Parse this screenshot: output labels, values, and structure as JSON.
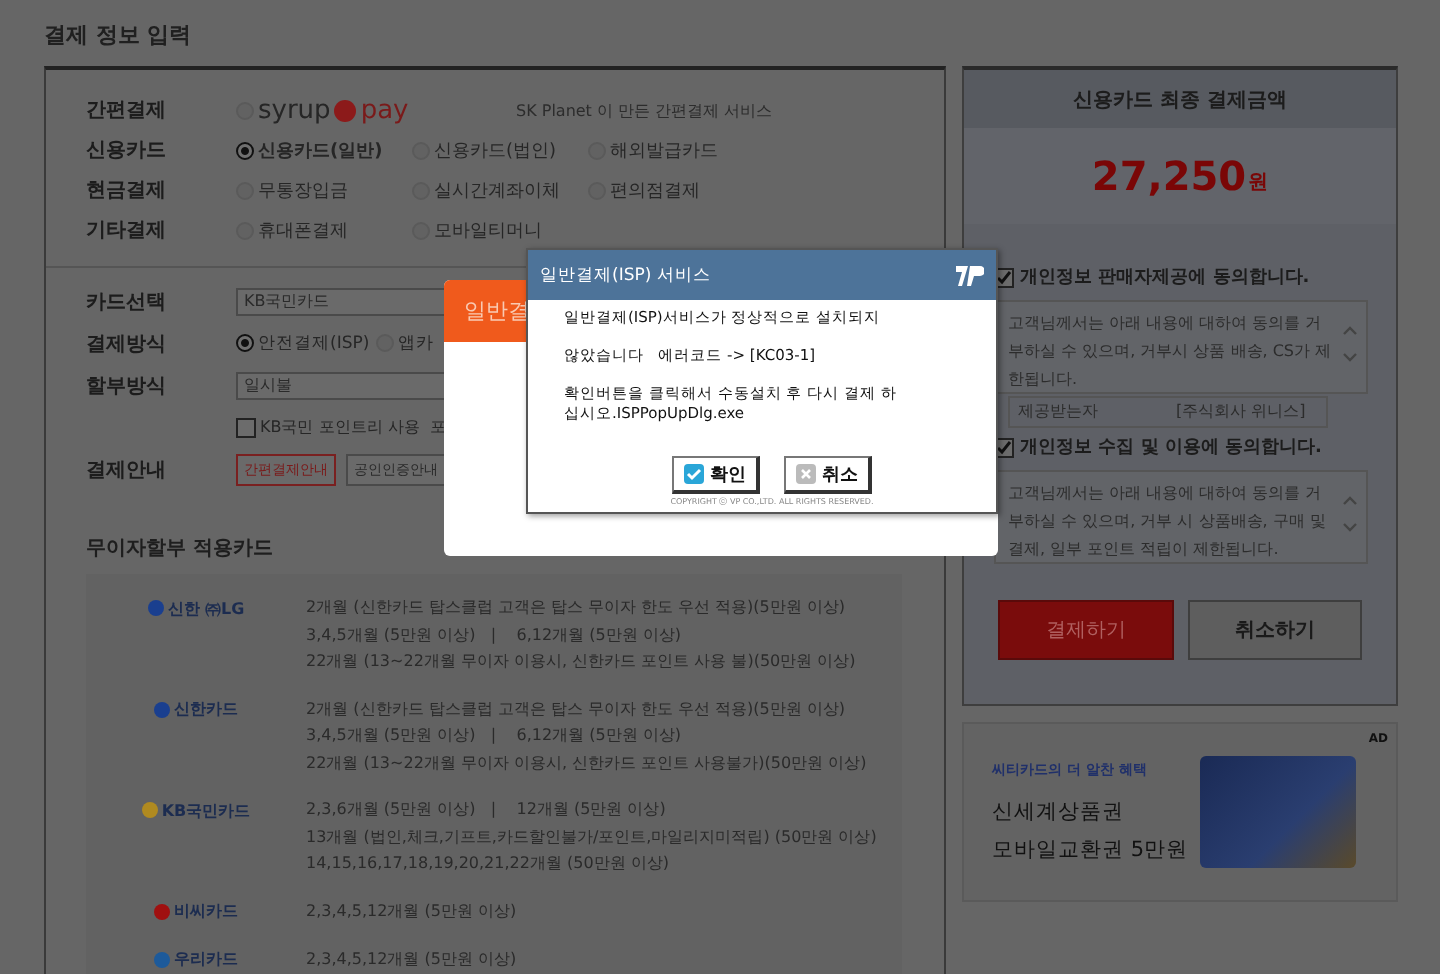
{
  "page_title": "결제 정보 입력",
  "methods": [
    {
      "label": "간편결제",
      "kind": "syrup",
      "options": [
        {
          "brand_left": "syrup",
          "brand_right": "pay",
          "selected": false
        }
      ],
      "note": "SK Planet 이 만든 간편결제 서비스"
    },
    {
      "label": "신용카드",
      "kind": "radios",
      "options": [
        {
          "label": "신용카드(일반)",
          "selected": true
        },
        {
          "label": "신용카드(법인)",
          "selected": false
        },
        {
          "label": "해외발급카드",
          "selected": false
        }
      ]
    },
    {
      "label": "현금결제",
      "kind": "radios",
      "options": [
        {
          "label": "무통장입금",
          "selected": false
        },
        {
          "label": "실시간계좌이체",
          "selected": false
        },
        {
          "label": "편의점결제",
          "selected": false
        }
      ]
    },
    {
      "label": "기타결제",
      "kind": "radios",
      "options": [
        {
          "label": "휴대폰결제",
          "selected": false
        },
        {
          "label": "모바일티머니",
          "selected": false
        }
      ]
    }
  ],
  "card_form": [
    {
      "label": "카드선택",
      "kind": "select",
      "value": "KB국민카드"
    },
    {
      "label": "결제방식",
      "kind": "radios",
      "options": [
        {
          "label": "안전결제(ISP)",
          "selected": true
        },
        {
          "label": "앱카",
          "selected": false
        }
      ]
    },
    {
      "label": "할부방식",
      "kind": "select",
      "value": "일시불"
    },
    {
      "kind": "checkbox",
      "text": "KB국민 포인트리 사용  포",
      "checked": false
    },
    {
      "label": "결제안내",
      "kind": "buttons",
      "buttons": [
        {
          "text": "간편결제안내",
          "highlighted": true
        },
        {
          "text": "공인인증안내",
          "highlighted": false
        }
      ]
    }
  ],
  "installment": {
    "title": "무이자할부 적용카드",
    "cards": [
      {
        "logo": "신한 ㈜LG",
        "color": "#1a3f8f",
        "lines": [
          "2개월 (신한카드 탑스클럽 고객은 탑스 무이자 한도 우선 적용)(5만원 이상)",
          "3,4,5개월 (5만원 이상)   |    6,12개월 (5만원 이상)",
          "22개월 (13~22개월 무이자 이용시, 신한카드 포인트 사용 불)(50만원 이상)"
        ]
      },
      {
        "logo": "신한카드",
        "color": "#1a3f8f",
        "lines": [
          "2개월 (신한카드 탑스클럽 고객은 탑스 무이자 한도 우선 적용)(5만원 이상)",
          "3,4,5개월 (5만원 이상)   |    6,12개월 (5만원 이상)",
          "22개월 (13~22개월 무이자 이용시, 신한카드 포인트 사용불가)(50만원 이상)"
        ]
      },
      {
        "logo": "KB국민카드",
        "color": "#b08a20",
        "lines": [
          "2,3,6개월 (5만원 이상)   |    12개월 (5만원 이상)",
          "13개월 (법인,체크,기프트,카드할인불가/포인트,마일리지미적립) (50만원 이상)",
          "14,15,16,17,18,19,20,21,22개월 (50만원 이상)"
        ]
      },
      {
        "logo": "비씨카드",
        "color": "#a01010",
        "lines": [
          "2,3,4,5,12개월 (5만원 이상)"
        ]
      },
      {
        "logo": "우리카드",
        "color": "#1d5a9a",
        "lines": [
          "2,3,4,5,12개월 (5만원 이상)"
        ]
      }
    ]
  },
  "summary": {
    "title": "신용카드 최종 결제금액",
    "amount": "27,250",
    "unit": "원",
    "agreements": [
      {
        "label": "개인정보 판매자제공에 동의합니다.",
        "checked": true,
        "text": "고객님께서는 아래 내용에 대하여 동의를 거부하실 수 있으며, 거부시 상품 배송, CS가 제한됩니다.",
        "table": [
          "제공받는자",
          "[주식회사 위니스]"
        ]
      },
      {
        "label": "개인정보 수집 및 이용에 동의합니다.",
        "checked": true,
        "text": "고객님께서는 아래 내용에 대하여 동의를 거부하실 수 있으며, 거부 시 상품배송, 구매 및 결제, 일부 포인트 적립이 제한됩니다."
      }
    ],
    "pay_button": "결제하기",
    "cancel_button": "취소하기"
  },
  "ad": {
    "badge": "AD",
    "kicker": "씨티카드의 더 알찬 혜택",
    "headline": [
      "신세계상품권",
      "모바일교환권 5만원"
    ]
  },
  "modal": {
    "title": "일반결"
  },
  "dialog": {
    "title": "일반결제(ISP) 서비스",
    "lines": [
      "일반결제(ISP)서비스가 정상적으로 설치되지",
      "않았습니다   에러코드 -> [KC03-1]",
      "확인버튼을 클릭해서 수동설치 후 다시 결제 하\n십시오.ISPPopUpDlg.exe"
    ],
    "ok": "확인",
    "cancel": "취소",
    "copyright": "COPYRIGHT ⓒ VP CO.,LTD. ALL RIGHTS RESERVED."
  }
}
